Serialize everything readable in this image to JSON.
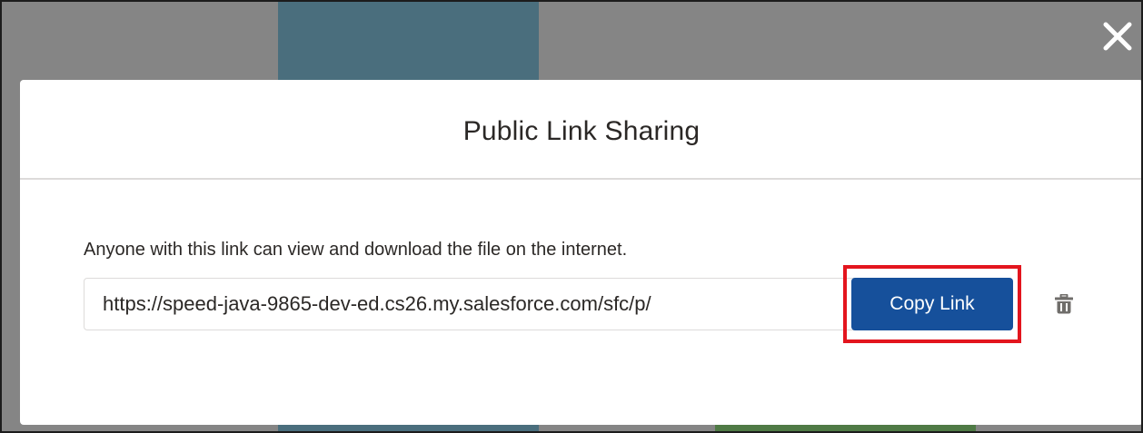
{
  "modal": {
    "title": "Public Link Sharing",
    "description": "Anyone with this link can view and download the file on the internet.",
    "link_value": "https://speed-java-9865-dev-ed.cs26.my.salesforce.com/sfc/p/",
    "copy_label": "Copy Link"
  },
  "icons": {
    "close": "close-icon",
    "delete": "trash-icon"
  },
  "colors": {
    "overlay": "#858585",
    "primary_button": "#16509b",
    "highlight_box": "#e3151e",
    "close_icon": "#ffffff",
    "trash_icon": "#706e6b"
  }
}
